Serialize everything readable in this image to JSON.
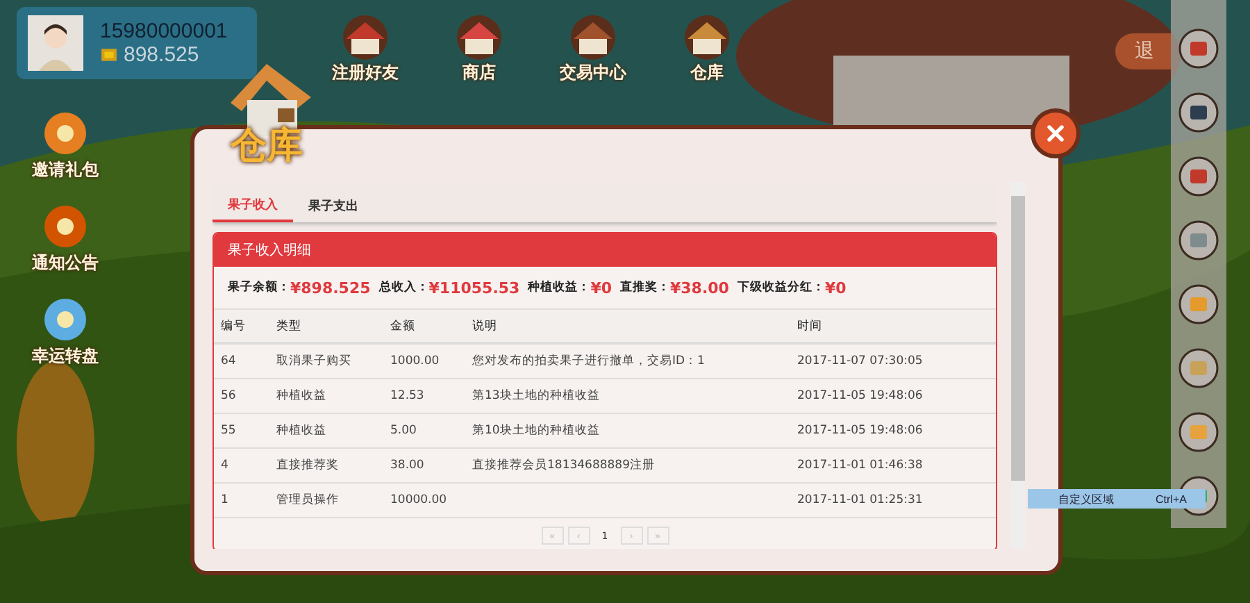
{
  "player": {
    "phone": "15980000001",
    "coins": "898.525"
  },
  "top_nav": [
    {
      "label": "注册好友",
      "kind": "barn"
    },
    {
      "label": "商店",
      "kind": "shop"
    },
    {
      "label": "交易中心",
      "kind": "chest"
    },
    {
      "label": "仓库",
      "kind": "house"
    }
  ],
  "side_menu": [
    {
      "label": "邀请礼包",
      "kind": "gift"
    },
    {
      "label": "通知公告",
      "kind": "horn"
    },
    {
      "label": "幸运转盘",
      "kind": "wheel"
    }
  ],
  "exit_button": "退",
  "tool_bar": [
    {
      "kind": "shop"
    },
    {
      "kind": "shovel"
    },
    {
      "kind": "pepper"
    },
    {
      "kind": "spade"
    },
    {
      "kind": "plot"
    },
    {
      "kind": "sack"
    },
    {
      "kind": "wing"
    },
    {
      "kind": "cycle"
    }
  ],
  "capture_hint": {
    "label": "自定义区域",
    "shortcut": "Ctrl+A"
  },
  "dialog": {
    "title": "仓库",
    "tabs": [
      {
        "label": "果子收入",
        "selected": true
      },
      {
        "label": "果子支出",
        "selected": false
      }
    ],
    "panel_title": "果子收入明细",
    "stats": [
      {
        "label": "果子余额：",
        "amount": "¥898.525"
      },
      {
        "label": "总收入：",
        "amount": "¥11055.53"
      },
      {
        "label": "种植收益：",
        "amount": "¥0"
      },
      {
        "label": "直推奖：",
        "amount": "¥38.00"
      },
      {
        "label": "下级收益分红：",
        "amount": "¥0"
      }
    ],
    "columns": [
      "编号",
      "类型",
      "金额",
      "说明",
      "时间"
    ],
    "rows": [
      [
        "64",
        "取消果子购买",
        "1000.00",
        "您对发布的拍卖果子进行撤单，交易ID：1",
        "2017-11-07 07:30:05"
      ],
      [
        "56",
        "种植收益",
        "12.53",
        "第13块土地的种植收益",
        "2017-11-05 19:48:06"
      ],
      [
        "55",
        "种植收益",
        "5.00",
        "第10块土地的种植收益",
        "2017-11-05 19:48:06"
      ],
      [
        "4",
        "直接推荐奖",
        "38.00",
        "直接推荐会员18134688889注册",
        "2017-11-01 01:46:38"
      ],
      [
        "1",
        "管理员操作",
        "10000.00",
        "",
        "2017-11-01 01:25:31"
      ]
    ],
    "pager": {
      "first": "«",
      "prev": "‹",
      "page": "1",
      "next": "›",
      "last": "»"
    }
  }
}
